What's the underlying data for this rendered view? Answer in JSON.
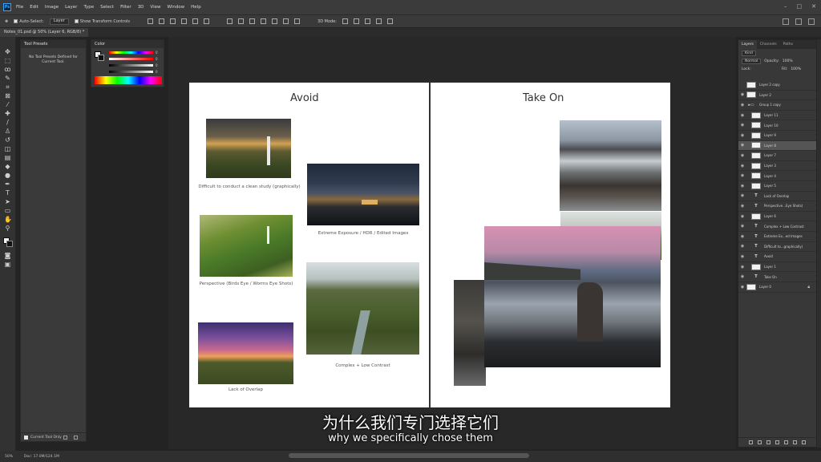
{
  "app": {
    "logo": "Ps",
    "menu": [
      "File",
      "Edit",
      "Image",
      "Layer",
      "Type",
      "Select",
      "Filter",
      "3D",
      "View",
      "Window",
      "Help"
    ],
    "window_controls": [
      "–",
      "□",
      "✕"
    ]
  },
  "options_bar": {
    "auto_select_label": "Auto-Select:",
    "auto_select_value": "Layer",
    "transform_controls_label": "Show Transform Controls",
    "mode_label": "3D Mode:"
  },
  "document": {
    "tab_title": "Notes_01.psd @ 50% (Layer 6, RGB/8) *"
  },
  "tool_presets": {
    "title": "Tool Presets",
    "empty_message": "No Tool Presets Defined for Current Tool.",
    "current_tool_only_label": "Current Tool Only"
  },
  "color_panel": {
    "title": "Color",
    "values": [
      "0",
      "0",
      "0",
      "0"
    ],
    "percent": "%"
  },
  "layers_panel": {
    "tabs": [
      "Layers",
      "Channels",
      "Paths"
    ],
    "filter": "Kind",
    "blend_mode": "Normal",
    "opacity_label": "Opacity:",
    "opacity_value": "100%",
    "lock_label": "Lock:",
    "fill_label": "Fill:",
    "fill_value": "100%",
    "layers": [
      {
        "name": "Layer 2 copy",
        "kind": "pixel",
        "visible": false,
        "indent": false
      },
      {
        "name": "Layer 2",
        "kind": "pixel",
        "visible": true,
        "indent": false
      },
      {
        "name": "Group 1 copy",
        "kind": "group",
        "visible": true,
        "indent": false
      },
      {
        "name": "Layer 11",
        "kind": "pixel",
        "visible": true,
        "indent": true
      },
      {
        "name": "Layer 10",
        "kind": "pixel",
        "visible": true,
        "indent": true
      },
      {
        "name": "Layer 9",
        "kind": "pixel",
        "visible": true,
        "indent": true
      },
      {
        "name": "Layer 8",
        "kind": "pixel",
        "visible": true,
        "indent": true
      },
      {
        "name": "Layer 7",
        "kind": "pixel",
        "visible": true,
        "indent": true
      },
      {
        "name": "Layer 3",
        "kind": "pixel",
        "visible": true,
        "indent": true
      },
      {
        "name": "Layer 4",
        "kind": "pixel",
        "visible": true,
        "indent": true
      },
      {
        "name": "Layer 5",
        "kind": "pixel",
        "visible": true,
        "indent": true
      },
      {
        "name": "Lack of Overlap",
        "kind": "text",
        "visible": true,
        "indent": true
      },
      {
        "name": "Perspective...Eye Shots)",
        "kind": "text",
        "visible": true,
        "indent": true
      },
      {
        "name": "Layer 6",
        "kind": "pixel",
        "visible": true,
        "indent": true
      },
      {
        "name": "Complex + Low Contrast",
        "kind": "text",
        "visible": true,
        "indent": true
      },
      {
        "name": "Extreme Ex...ed Images",
        "kind": "text",
        "visible": true,
        "indent": true
      },
      {
        "name": "Difficult to...graphically)",
        "kind": "text",
        "visible": true,
        "indent": true
      },
      {
        "name": "Avoid",
        "kind": "text",
        "visible": true,
        "indent": true
      },
      {
        "name": "Layer 1",
        "kind": "pixel",
        "visible": true,
        "indent": true
      },
      {
        "name": "Take On",
        "kind": "text",
        "visible": true,
        "indent": true
      },
      {
        "name": "Layer 0",
        "kind": "pixel",
        "visible": true,
        "indent": false,
        "locked": true
      }
    ],
    "selected_layer": "Layer 8"
  },
  "artboard": {
    "left_heading": "Avoid",
    "right_heading": "Take On",
    "captions": [
      "Difficult to conduct a clean study (graphically)",
      "Extreme Exposure / HDR / Edited Images",
      "Perspective (Birds Eye / Worms Eye Shots)",
      "Complex + Low Contrast",
      "Lack of Overlap"
    ]
  },
  "status_bar": {
    "zoom": "50%",
    "doc_size": "Doc: 17.0M/124.1M"
  },
  "subtitles": {
    "zh": "为什么我们专门选择它们",
    "en": "why we specifically chose them"
  }
}
